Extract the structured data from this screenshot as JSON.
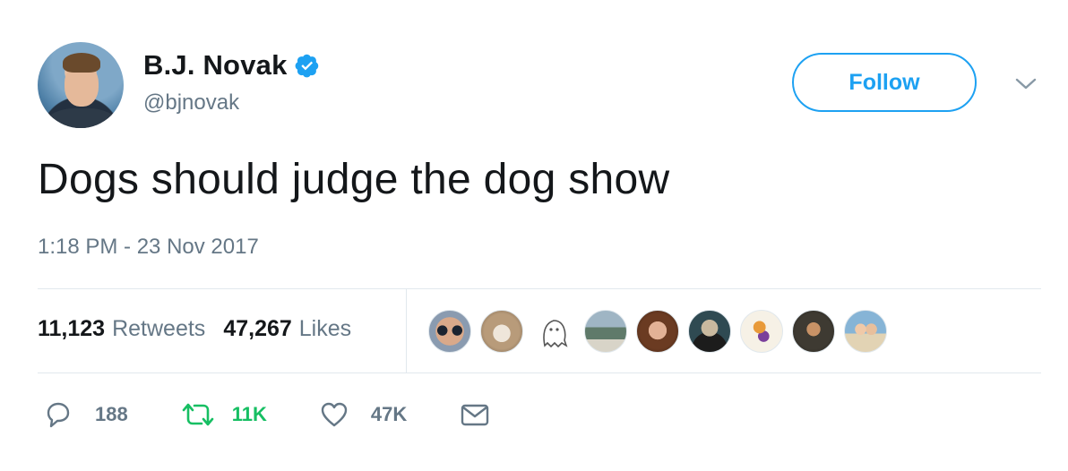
{
  "user": {
    "name": "B.J. Novak",
    "handle": "@bjnovak",
    "verified": true
  },
  "follow_label": "Follow",
  "tweet": {
    "text": "Dogs should judge the dog show",
    "timestamp": "1:18 PM - 23 Nov 2017"
  },
  "stats": {
    "retweets_count": "11,123",
    "retweets_label": "Retweets",
    "likes_count": "47,267",
    "likes_label": "Likes"
  },
  "actions": {
    "reply_count": "188",
    "retweet_count": "11K",
    "like_count": "47K"
  },
  "colors": {
    "accent": "#1da1f2",
    "retweet": "#17bf63",
    "muted": "#657786"
  },
  "icons": [
    "verified-badge-icon",
    "chevron-down-icon",
    "reply-icon",
    "retweet-icon",
    "heart-icon",
    "mail-icon"
  ]
}
